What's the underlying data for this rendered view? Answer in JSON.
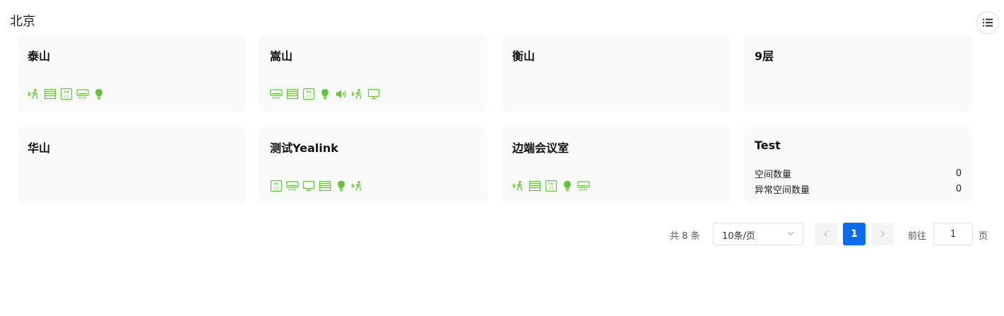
{
  "title": "北京",
  "colors": {
    "icon_green": "#67c23a",
    "page_active": "#0a6cf0"
  },
  "rooms": [
    {
      "name": "泰山",
      "icons": [
        "motion-sensor",
        "blinds",
        "pm-sensor",
        "air-conditioner",
        "light-bulb"
      ]
    },
    {
      "name": "嵩山",
      "icons": [
        "air-conditioner",
        "blinds",
        "pm-sensor",
        "light-bulb",
        "speaker",
        "motion-sensor",
        "monitor"
      ]
    },
    {
      "name": "衡山",
      "icons": []
    },
    {
      "name": "9层",
      "icons": []
    },
    {
      "name": "华山",
      "icons": []
    },
    {
      "name": "测试Yealink",
      "icons": [
        "pm-sensor",
        "air-conditioner",
        "monitor",
        "blinds",
        "light-bulb",
        "motion-sensor"
      ]
    },
    {
      "name": "边端会议室",
      "icons": [
        "motion-sensor",
        "blinds",
        "pm-sensor",
        "light-bulb",
        "air-conditioner"
      ]
    },
    {
      "name": "Test",
      "icons": [],
      "stats": [
        {
          "label": "空间数量",
          "value": "0"
        },
        {
          "label": "异常空间数量",
          "value": "0"
        }
      ]
    }
  ],
  "pagination": {
    "total_text": "共 8 条",
    "page_size": "10条/页",
    "current_page": "1",
    "goto_label": "前往",
    "goto_value": "1",
    "page_unit": "页"
  }
}
